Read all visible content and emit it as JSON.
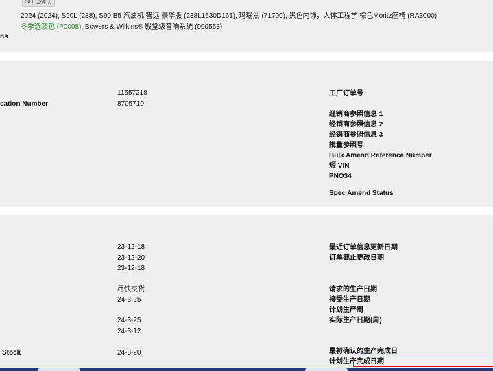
{
  "options": {
    "badge": "SO 已确认",
    "line1": "2024 (2024), S90L (238), S90 B5 汽油机 智远 豪华版 (238L1630D161), 玛瑙黑 (71700), 黑色内饰，人体工程学 棕色Moritz座椅 (RA3000)",
    "line2_green": "冬季选装包 (P0008)",
    "line2_rest": ", Bowers & Wilkins® 殿堂级音响系统 (000553)",
    "side_label": "ns"
  },
  "order": {
    "left_label": "cation Number",
    "values": [
      "11657218",
      "8705710"
    ],
    "right_labels": [
      "工厂订单号",
      "经销商参照信息 1",
      "经销商参照信息 2",
      "经销商参照信息 3",
      "批量参照号",
      "Bulk Amend Reference Number",
      "短 VIN",
      "PNO34",
      "Spec Amend Status"
    ]
  },
  "dates": {
    "left_label": "Stock",
    "values": [
      "23-12-18",
      "23-12-20",
      "23-12-18",
      "尽快交货",
      "24-3-25",
      "24-3-25",
      "24-3-12",
      "24-3-20"
    ],
    "right_labels": [
      "最近订单信息更新日期",
      "订单截止更改日期",
      "请求的生产日期",
      "接受生产日期",
      "计划生产周",
      "实际生产日期(周)",
      "最初确认的生产完成日",
      "计划生产完成日期"
    ]
  }
}
